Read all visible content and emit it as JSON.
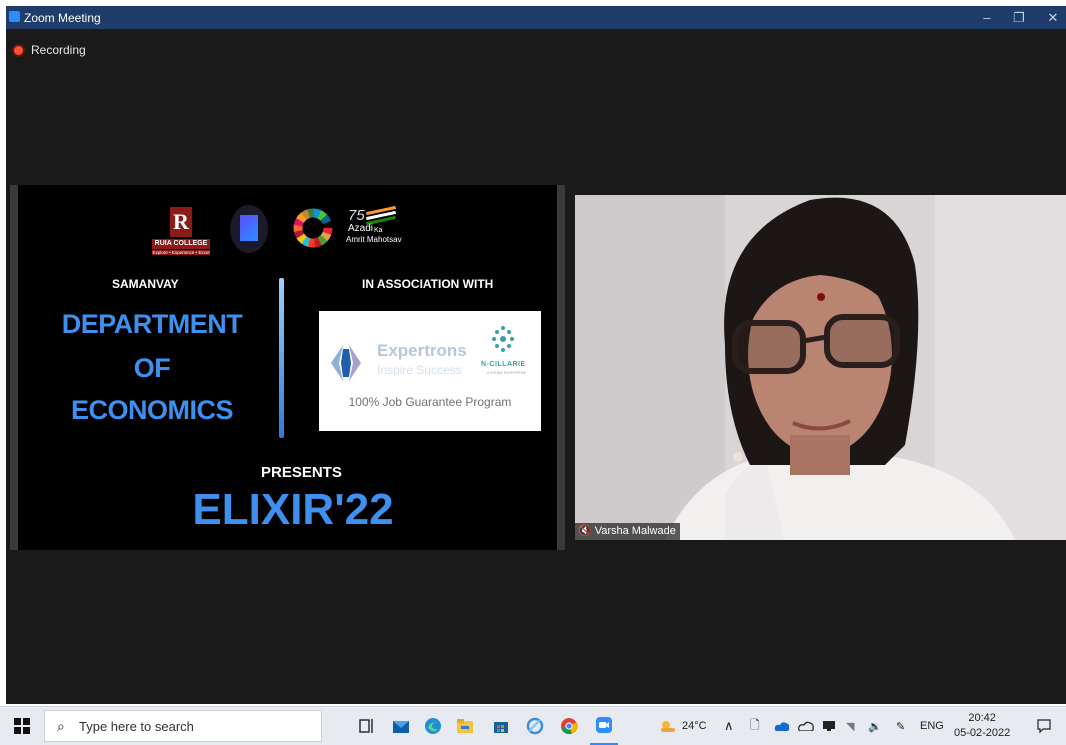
{
  "window": {
    "title": "Zoom Meeting",
    "minimize": "–",
    "restore": "❐",
    "close": "✕"
  },
  "status": {
    "recording_label": "Recording"
  },
  "slide": {
    "ruia_letter": "R",
    "ruia_name": "RUIA COLLEGE",
    "ruia_tagline": "Explore • Experience • Excel",
    "azadi_text": "Azadi",
    "azadi_ka": "Ka",
    "azadi_sub": "Amrit Mahotsav",
    "azadi_75": "75",
    "samanvay": "SAMANVAY",
    "association": "IN ASSOCIATION WITH",
    "department_lines": [
      "DEPARTMENT",
      "OF",
      "ECONOMICS"
    ],
    "sponsor_name": "Expertrons",
    "sponsor_tagline": "Inspire Success",
    "partner_name": "N-CILLARIE",
    "partner_sub": "A YOUNG ENTERPRISE",
    "program_label": "100% Job Guarantee Program",
    "presents": "PRESENTS",
    "event_title": "ELIXIR'22"
  },
  "participant": {
    "name": "Varsha Malwade",
    "muted": true
  },
  "taskbar": {
    "search_placeholder": "Type here to search",
    "weather": "24°C",
    "language": "ENG",
    "time": "20:42",
    "date": "05-02-2022",
    "pinned_apps": [
      "task-view",
      "mail",
      "edge",
      "file-explorer",
      "store",
      "browser-blue",
      "chrome",
      "zoom"
    ]
  }
}
